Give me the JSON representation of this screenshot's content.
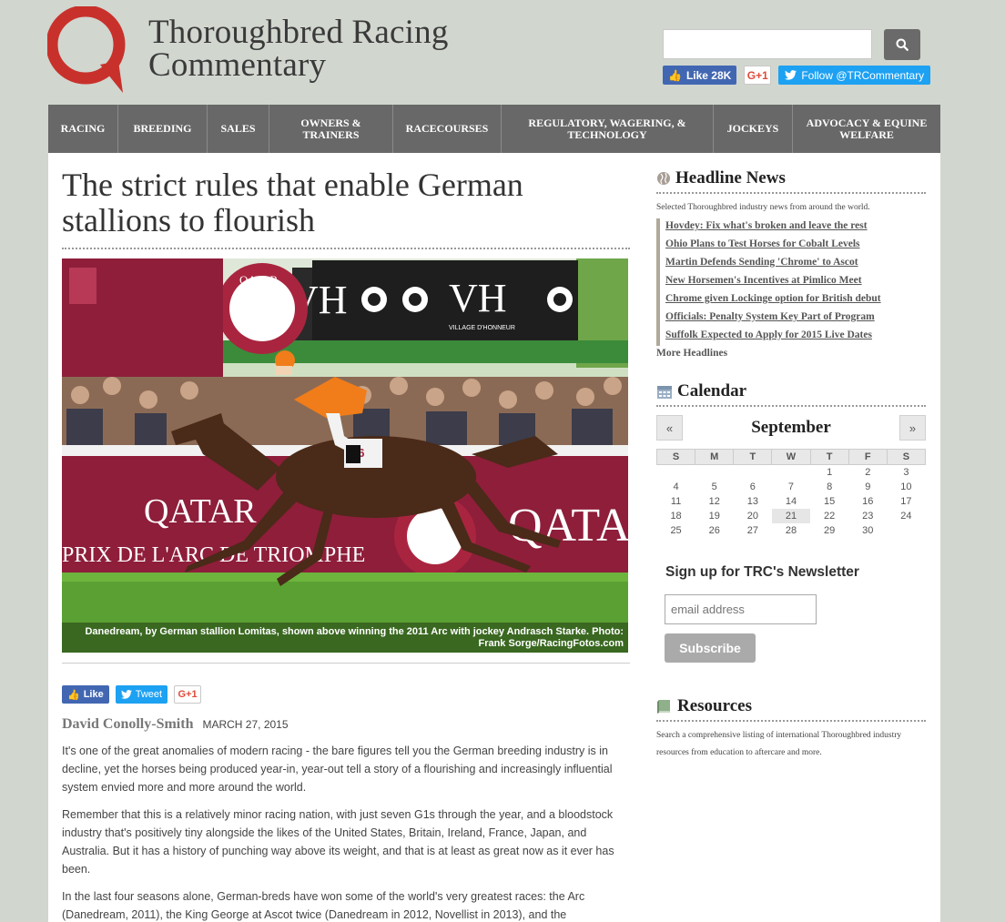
{
  "header": {
    "site_title_line1": "Thoroughbred Racing",
    "site_title_line2": "Commentary",
    "search_placeholder": "",
    "social": {
      "fb_label": "Like 28K",
      "gplus_label": "G+1",
      "twitter_label": "Follow @TRCommentary"
    }
  },
  "nav": [
    {
      "label": "Racing"
    },
    {
      "label": "Breeding"
    },
    {
      "label": "Sales"
    },
    {
      "label": "Owners & Trainers"
    },
    {
      "label": "Racecourses"
    },
    {
      "label": "Regulatory, Wagering, & Technology"
    },
    {
      "label": "Jockeys"
    },
    {
      "label": "Advocacy & Equine Welfare"
    }
  ],
  "article": {
    "title": "The strict rules that enable German stallions to flourish",
    "image_caption": "Danedream, by German stallion Lomitas, shown above winning the 2011 Arc with jockey Andrasch Starke. Photo: Frank Sorge/RacingFotos.com",
    "share": {
      "like": "Like",
      "tweet": "Tweet",
      "gplus": "G+1"
    },
    "author": "David Conolly-Smith",
    "date": "MARCH 27, 2015",
    "paragraphs": [
      "It's one of the great anomalies of modern racing - the bare figures tell you the German breeding industry is in decline, yet the horses being produced year-in, year-out tell a story of a flourishing and increasingly influential system envied more and more around the world.",
      "Remember that this is a relatively minor racing nation, with just seven G1s through the year, and a bloodstock industry that's positively tiny alongside the likes of the United States, Britain, Ireland, France, Japan, and Australia. But it has a history of punching way above its weight, and that is at least as great now as it ever has been.",
      "In the last four seasons alone, German-breds have won some of the world's very greatest races: the Arc (Danedream, 2011), the King George at Ascot twice (Danedream in 2012, Novellist in 2013), and the"
    ],
    "image_signage": {
      "qatar": "QATAR",
      "arc_banner": "PRIX DE L'ARC DE TRIOMPHE",
      "vh": "VH",
      "village": "VILLAGE D'HONNEUR",
      "number": "16"
    }
  },
  "sidebar": {
    "headline_news": {
      "title": "Headline News",
      "description": "Selected Thoroughbred industry news from around the world.",
      "items": [
        "Hovdey: Fix what's broken and leave the rest",
        "Ohio Plans to Test Horses for Cobalt Levels",
        "Martin Defends Sending 'Chrome' to Ascot",
        "New Horsemen's Incentives at Pimlico Meet",
        "Chrome given Lockinge option for British debut",
        "Officials: Penalty System Key Part of Program",
        "Suffolk Expected to Apply for 2015 Live Dates"
      ],
      "more": "More Headlines"
    },
    "calendar": {
      "title": "Calendar",
      "month": "September",
      "prev": "«",
      "next": "»",
      "weekdays": [
        "S",
        "M",
        "T",
        "W",
        "T",
        "F",
        "S"
      ],
      "weeks": [
        [
          "",
          "",
          "",
          "",
          "1",
          "2",
          "3"
        ],
        [
          "4",
          "5",
          "6",
          "7",
          "8",
          "9",
          "10"
        ],
        [
          "11",
          "12",
          "13",
          "14",
          "15",
          "16",
          "17"
        ],
        [
          "18",
          "19",
          "20",
          "21",
          "22",
          "23",
          "24"
        ],
        [
          "25",
          "26",
          "27",
          "28",
          "29",
          "30",
          ""
        ]
      ],
      "today": "21"
    },
    "newsletter": {
      "title": "Sign up for TRC's Newsletter",
      "placeholder": "email address",
      "button": "Subscribe"
    },
    "resources": {
      "title": "Resources",
      "description": "Search a comprehensive listing of international Thoroughbred industry resources from education to aftercare and more."
    }
  },
  "colors": {
    "page_bg": "#d1d6cf",
    "nav_bg": "#686868",
    "logo_red": "#c8312b",
    "fb_blue": "#4267b2",
    "twitter_blue": "#1da1f2"
  }
}
